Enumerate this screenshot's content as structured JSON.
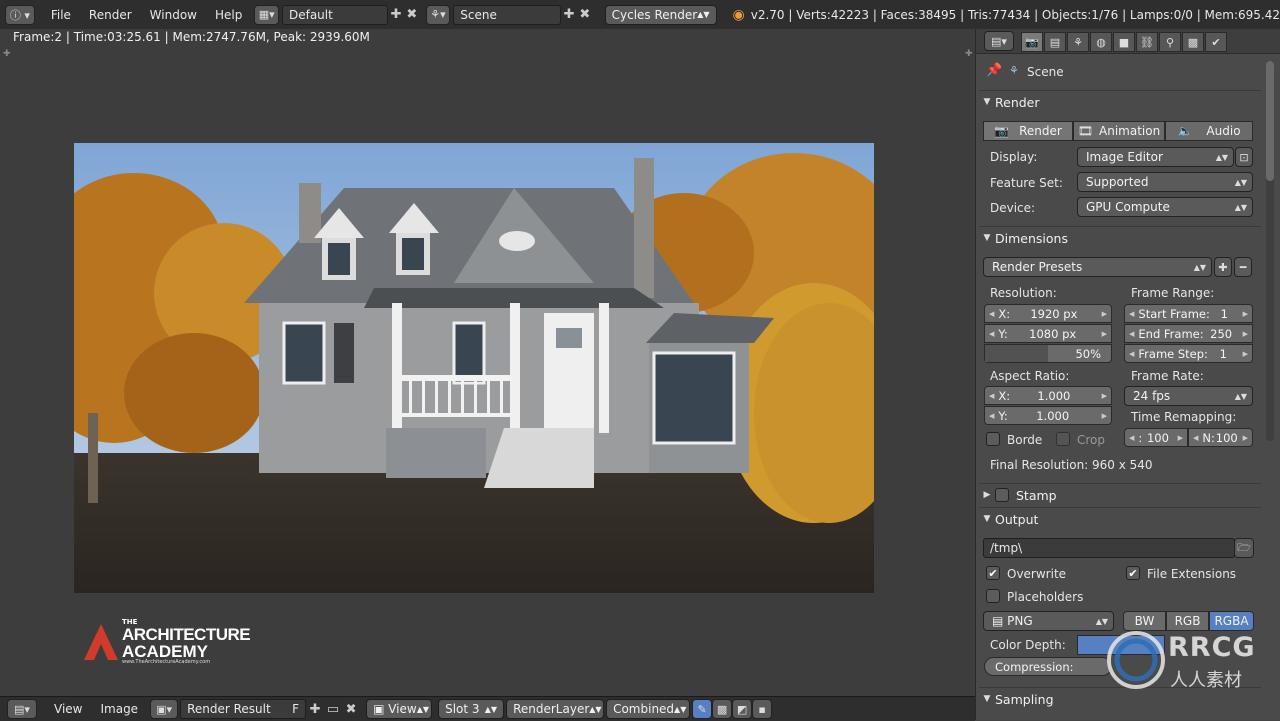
{
  "colors": {
    "topbar": "#2e2e2e",
    "viewer": "#3d3d3d",
    "panel": "#4a4a4a",
    "accent_blue": "#5680c2",
    "sky": "#8fb0d8"
  },
  "topbar": {
    "info_icon": "info-icon",
    "menus": [
      "File",
      "Render",
      "Window",
      "Help"
    ],
    "layout_name": "Default",
    "scene_name": "Scene",
    "engine": "Cycles Render",
    "stats": "v2.70 | Verts:42223 | Faces:38495 | Tris:77434 | Objects:1/76 | Lamps:0/0 | Mem:695.42"
  },
  "viewer": {
    "info_line": "Frame:2 | Time:03:25.61 | Mem:2747.76M, Peak: 2939.60M",
    "logo": {
      "line1": "THE",
      "line2": "ARCHITECTURE",
      "line3": "ACADEMY",
      "url": "www.TheArchitectureAcademy.com"
    }
  },
  "bottombar": {
    "menus": [
      "View",
      "Image"
    ],
    "image_name": "Render Result",
    "fake_user": "F",
    "view_label": "View",
    "slot": "Slot 3",
    "render_layer": "RenderLayer",
    "pass": "Combined"
  },
  "properties": {
    "context": "Scene",
    "render": {
      "title": "Render",
      "buttons": [
        "Render",
        "Animation",
        "Audio"
      ],
      "display_label": "Display:",
      "display_value": "Image Editor",
      "feature_label": "Feature Set:",
      "feature_value": "Supported",
      "device_label": "Device:",
      "device_value": "GPU Compute"
    },
    "dimensions": {
      "title": "Dimensions",
      "presets": "Render Presets",
      "resolution_label": "Resolution:",
      "res_x_label": "X:",
      "res_x": "1920 px",
      "res_y_label": "Y:",
      "res_y": "1080 px",
      "res_pct": "50%",
      "res_pct_fraction": 0.5,
      "frame_range_label": "Frame Range:",
      "start_label": "Start Frame:",
      "start": "1",
      "end_label": "End Frame:",
      "end": "250",
      "step_label": "Frame Step:",
      "step": "1",
      "aspect_label": "Aspect Ratio:",
      "aspect_x_label": "X:",
      "aspect_x": "1.000",
      "aspect_y_label": "Y:",
      "aspect_y": "1.000",
      "frame_rate_label": "Frame Rate:",
      "frame_rate": "24 fps",
      "border_label": "Borde",
      "crop_label": "Crop",
      "remap_label": "Time Remapping:",
      "remap_old_label": ":",
      "remap_old": "100",
      "remap_new_label": "N:",
      "remap_new": "100",
      "final_resolution": "Final Resolution: 960 x 540"
    },
    "stamp": {
      "title": "Stamp"
    },
    "output": {
      "title": "Output",
      "path": "/tmp\\",
      "overwrite_label": "Overwrite",
      "file_ext_label": "File Extensions",
      "placeholders_label": "Placeholders",
      "format": "PNG",
      "color_modes": [
        "BW",
        "RGB",
        "RGBA"
      ],
      "color_mode_selected": "RGBA",
      "color_depth_label": "Color Depth:",
      "compression_label": "Compression:"
    },
    "sampling": {
      "title": "Sampling"
    }
  },
  "watermark": {
    "logo_text": "RRCG",
    "sub_text": "人人素材"
  }
}
